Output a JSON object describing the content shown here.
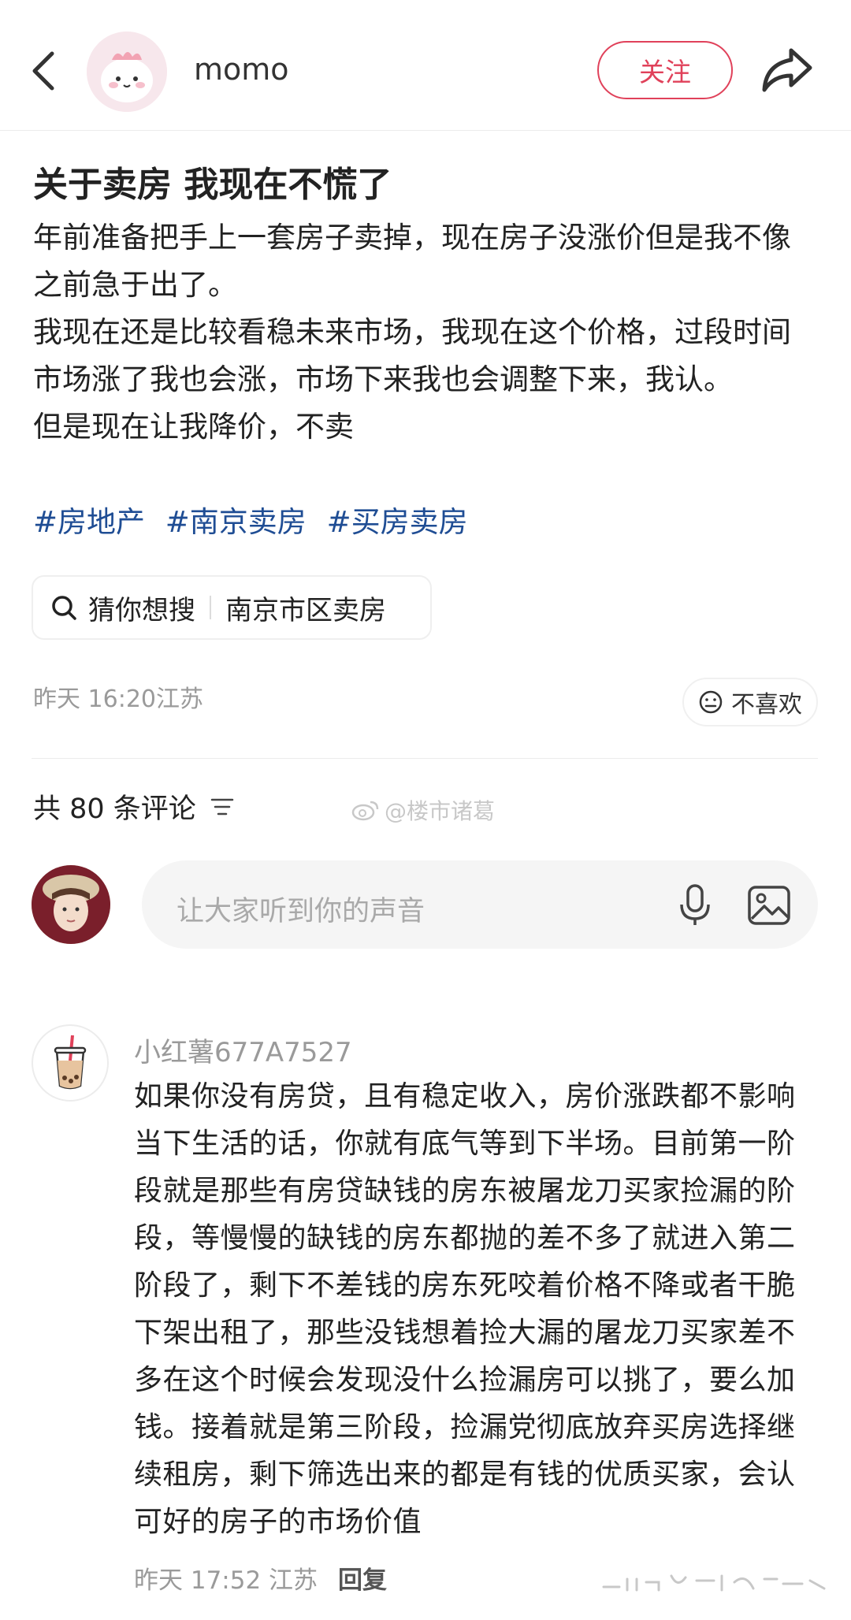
{
  "header": {
    "back_icon": "chevron-left-icon",
    "author_name": "momo",
    "follow_label": "关注",
    "share_icon": "share-arrow-icon",
    "accent_color": "#e0415a"
  },
  "post": {
    "title": "关于卖房 我现在不慌了",
    "paragraphs": [
      "年前准备把手上一套房子卖掉，现在房子没涨价但是我不像之前急于出了。",
      "我现在还是比较看稳未来市场，我现在这个价格，过段时间市场涨了我也会涨，市场下来我也会调整下来，我认。",
      "但是现在让我降价，不卖"
    ],
    "tags": [
      "#房地产",
      "#南京卖房",
      "#买房卖房"
    ],
    "tag_color": "#1f4d94",
    "suggest": {
      "label": "猜你想搜",
      "query": "南京市区卖房",
      "icon": "search-icon"
    },
    "meta": "昨天 16:20江苏",
    "dislike_label": "不喜欢"
  },
  "comments_section": {
    "count_label": "共 80 条评论",
    "sort_icon": "sort-filter-icon",
    "watermark": "@楼市诸葛",
    "input_placeholder": "让大家听到你的声音",
    "mic_icon": "microphone-icon",
    "image_icon": "image-icon"
  },
  "comment": {
    "username": "小红薯677A7527",
    "text": "如果你没有房贷，且有稳定收入，房价涨跌都不影响当下生活的话，你就有底气等到下半场。目前第一阶段就是那些有房贷缺钱的房东被屠龙刀买家捡漏的阶段，等慢慢的缺钱的房东都抛的差不多了就进入第二阶段了，剩下不差钱的房东死咬着价格不降或者干脆下架出租了，那些没钱想着捡大漏的屠龙刀买家差不多在这个时候会发现没什么捡漏房可以挑了，要么加钱。接着就是第三阶段，捡漏党彻底放弃买房选择继续租房，剩下筛选出来的都是有钱的优质买家，会认可好的房子的市场价值",
    "time": "昨天 17:52 江苏",
    "reply_label": "回复"
  }
}
